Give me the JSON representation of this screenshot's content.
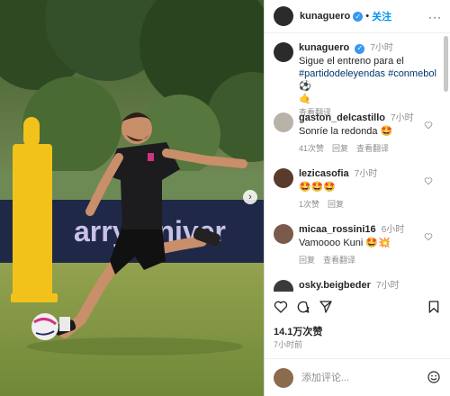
{
  "header": {
    "username": "kunaguero",
    "follow_label": "关注",
    "more_label": "···"
  },
  "caption": {
    "username": "kunaguero",
    "time": "7小时",
    "text_plain": "Sigue el entreno para el",
    "hashtags": "#partidodeleyendas #conmebol",
    "emoji": "⚽",
    "emoji2": "🤙",
    "see_translation": "查看翻译"
  },
  "comments": [
    {
      "username": "gaston_delcastillo",
      "time": "7小时",
      "text": "Sonríe la redonda 🤩",
      "likes": "41次赞",
      "reply": "回复",
      "translate": "查看翻译"
    },
    {
      "username": "lezicasofia",
      "time": "7小时",
      "text": "🤩🤩🤩",
      "likes": "1次赞",
      "reply": "回复"
    },
    {
      "username": "micaa_rossini16",
      "time": "6小时",
      "text": "Vamoooo Kuni 🤩💥",
      "reply": "回复",
      "translate": "查看翻译"
    },
    {
      "username": "osky.beigbeder",
      "time": "7小时"
    }
  ],
  "banner_text": "arry Univer",
  "stats": {
    "likes": "14.1万次赞",
    "time": "7小时前"
  },
  "composer": {
    "placeholder": "添加评论..."
  },
  "icons": {
    "like": "heart-icon",
    "comment": "comment-icon",
    "share": "send-icon",
    "save": "bookmark-icon",
    "emoji": "smiley-icon",
    "next": "chevron-right-icon"
  },
  "colors": {
    "link": "#00376b",
    "follow": "#0095f6",
    "verified": "#3897f0",
    "muted": "#8e8e8e"
  }
}
